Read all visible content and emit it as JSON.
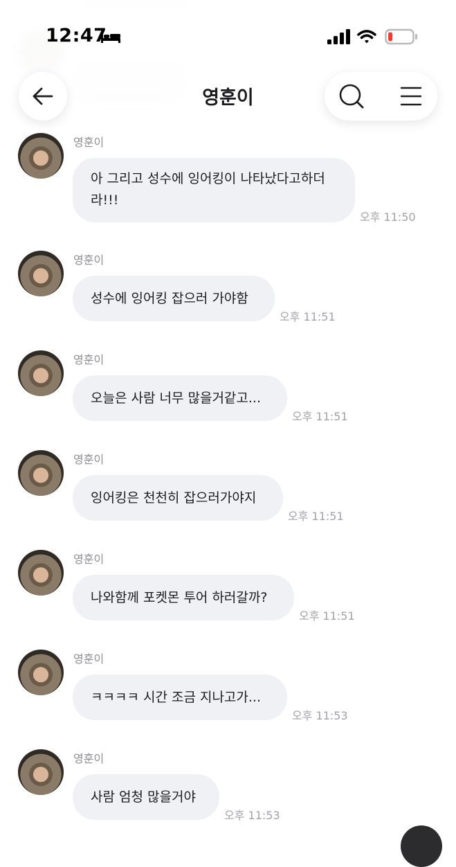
{
  "status_bar": {
    "time": "12:47",
    "icons": [
      "bed-icon",
      "signal-icon",
      "wifi-icon",
      "battery-low-icon"
    ],
    "battery_color": "#ff3b30"
  },
  "header": {
    "title": "영훈이",
    "back_icon": "arrow-left-icon",
    "search_icon": "search-icon",
    "menu_icon": "hamburger-menu-icon"
  },
  "messages": [
    {
      "sender": "영훈이",
      "lines": [
        "아 그리고 성수에 잉어킹이 나타났다고하더",
        "라!!!"
      ],
      "time": "오후 11:50"
    },
    {
      "sender": "영훈이",
      "lines": [
        "성수에 잉어킹 잡으러 가야함"
      ],
      "time": "오후 11:51"
    },
    {
      "sender": "영훈이",
      "lines": [
        "오늘은 사람 너무 많을거같고..."
      ],
      "time": "오후 11:51"
    },
    {
      "sender": "영훈이",
      "lines": [
        "잉어킹은 천천히 잡으러가야지"
      ],
      "time": "오후 11:51"
    },
    {
      "sender": "영훈이",
      "lines": [
        "나와함께 포켓몬 투어 하러갈까?"
      ],
      "time": "오후 11:51"
    },
    {
      "sender": "영훈이",
      "lines": [
        "ㅋㅋㅋㅋ 시간 조금 지나고가..."
      ],
      "time": "오후 11:53"
    },
    {
      "sender": "영훈이",
      "lines": [
        "사람 엄청 많을거야"
      ],
      "time": "오후 11:53"
    }
  ],
  "colors": {
    "bubble": "#f0f1f4",
    "meta_text": "#8e8e93"
  }
}
